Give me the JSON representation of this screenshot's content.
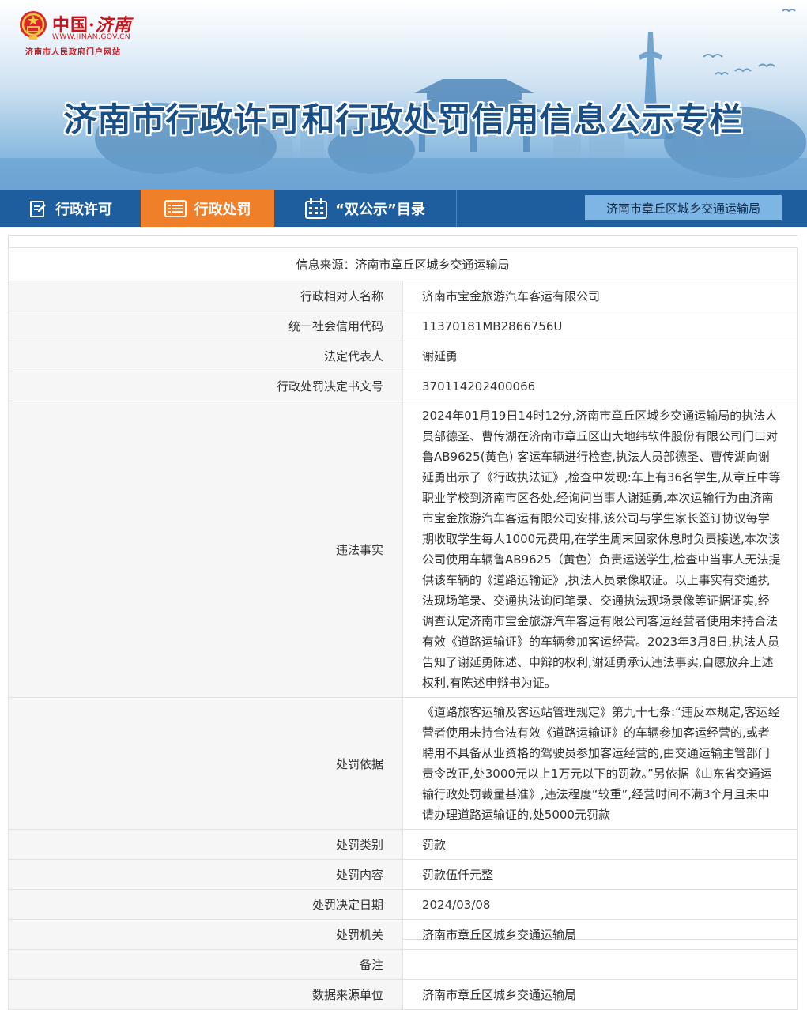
{
  "header": {
    "logo_cn": "中国",
    "logo_dot": "·",
    "logo_city": "济南",
    "logo_domain": "WWW.JINAN.GOV.CN",
    "logo_subtitle": "济南市人民政府门户网站",
    "title": "济南市行政许可和行政处罚信用信息公示专栏"
  },
  "nav": {
    "tabs": [
      {
        "label": "行政许可",
        "icon": "edit-icon"
      },
      {
        "label": "行政处罚",
        "icon": "list-icon",
        "active": true
      },
      {
        "label": "“双公示”目录",
        "icon": "calendar-icon"
      }
    ],
    "department": "济南市章丘区城乡交通运输局"
  },
  "record": {
    "source": "信息来源：济南市章丘区城乡交通运输局",
    "rows": [
      {
        "label": "行政相对人名称",
        "value": "济南市宝金旅游汽车客运有限公司"
      },
      {
        "label": "统一社会信用代码",
        "value": "11370181MB2866756U"
      },
      {
        "label": "法定代表人",
        "value": "谢延勇"
      },
      {
        "label": "行政处罚决定书文号",
        "value": "370114202400066"
      },
      {
        "label": "违法事实",
        "value": "2024年01月19日14时12分,济南市章丘区城乡交通运输局的执法人员部德圣、曹传湖在济南市章丘区山大地纬软件股份有限公司门口对鲁AB9625(黄色) 客运车辆进行检查,执法人员部德圣、曹传湖向谢延勇出示了《行政执法证》,检查中发现:车上有36名学生,从章丘中等职业学校到济南市区各处,经询问当事人谢延勇,本次运输行为由济南市宝金旅游汽车客运有限公司安排,该公司与学生家长签订协议每学期收取学生每人1000元费用,在学生周末回家休息时负责接送,本次该公司使用车辆鲁AB9625（黄色）负责运送学生,检查中当事人无法提供该车辆的《道路运输证》,执法人员录像取证。以上事实有交通执法现场笔录、交通执法询问笔录、交通执法现场录像等证据证实,经调查认定济南市宝金旅游汽车客运有限公司客运经营者使用未持合法有效《道路运输证》的车辆参加客运经营。2023年3月8日,执法人员告知了谢延勇陈述、申辩的权利,谢延勇承认违法事实,自愿放弃上述权利,有陈述申辩书为证。"
      },
      {
        "label": "处罚依据",
        "value": "《道路旅客运输及客运站管理规定》第九十七条:“违反本规定,客运经营者使用未持合法有效《道路运输证》的车辆参加客运经营的,或者聘用不具备从业资格的驾驶员参加客运经营的,由交通运输主管部门责令改正,处3000元以上1万元以下的罚款。”另依据《山东省交通运输行政处罚裁量基准》,违法程度“较重”,经营时间不满3个月且未申请办理道路运输证的,处5000元罚款"
      },
      {
        "label": "处罚类别",
        "value": "罚款"
      },
      {
        "label": "处罚内容",
        "value": "罚款伍仟元整"
      },
      {
        "label": "处罚决定日期",
        "value": "2024/03/08"
      },
      {
        "label": "处罚机关",
        "value": "济南市章丘区城乡交通运输局"
      },
      {
        "label": "备注",
        "value": ""
      },
      {
        "label": "数据来源单位",
        "value": "济南市章丘区城乡交通运输局"
      }
    ]
  },
  "colors": {
    "nav_bg": "#1f5e9e",
    "nav_active": "#f07f2a",
    "title": "#1a4f86",
    "logo_red": "#c8161d",
    "dept_bg": "#7db5e4"
  }
}
